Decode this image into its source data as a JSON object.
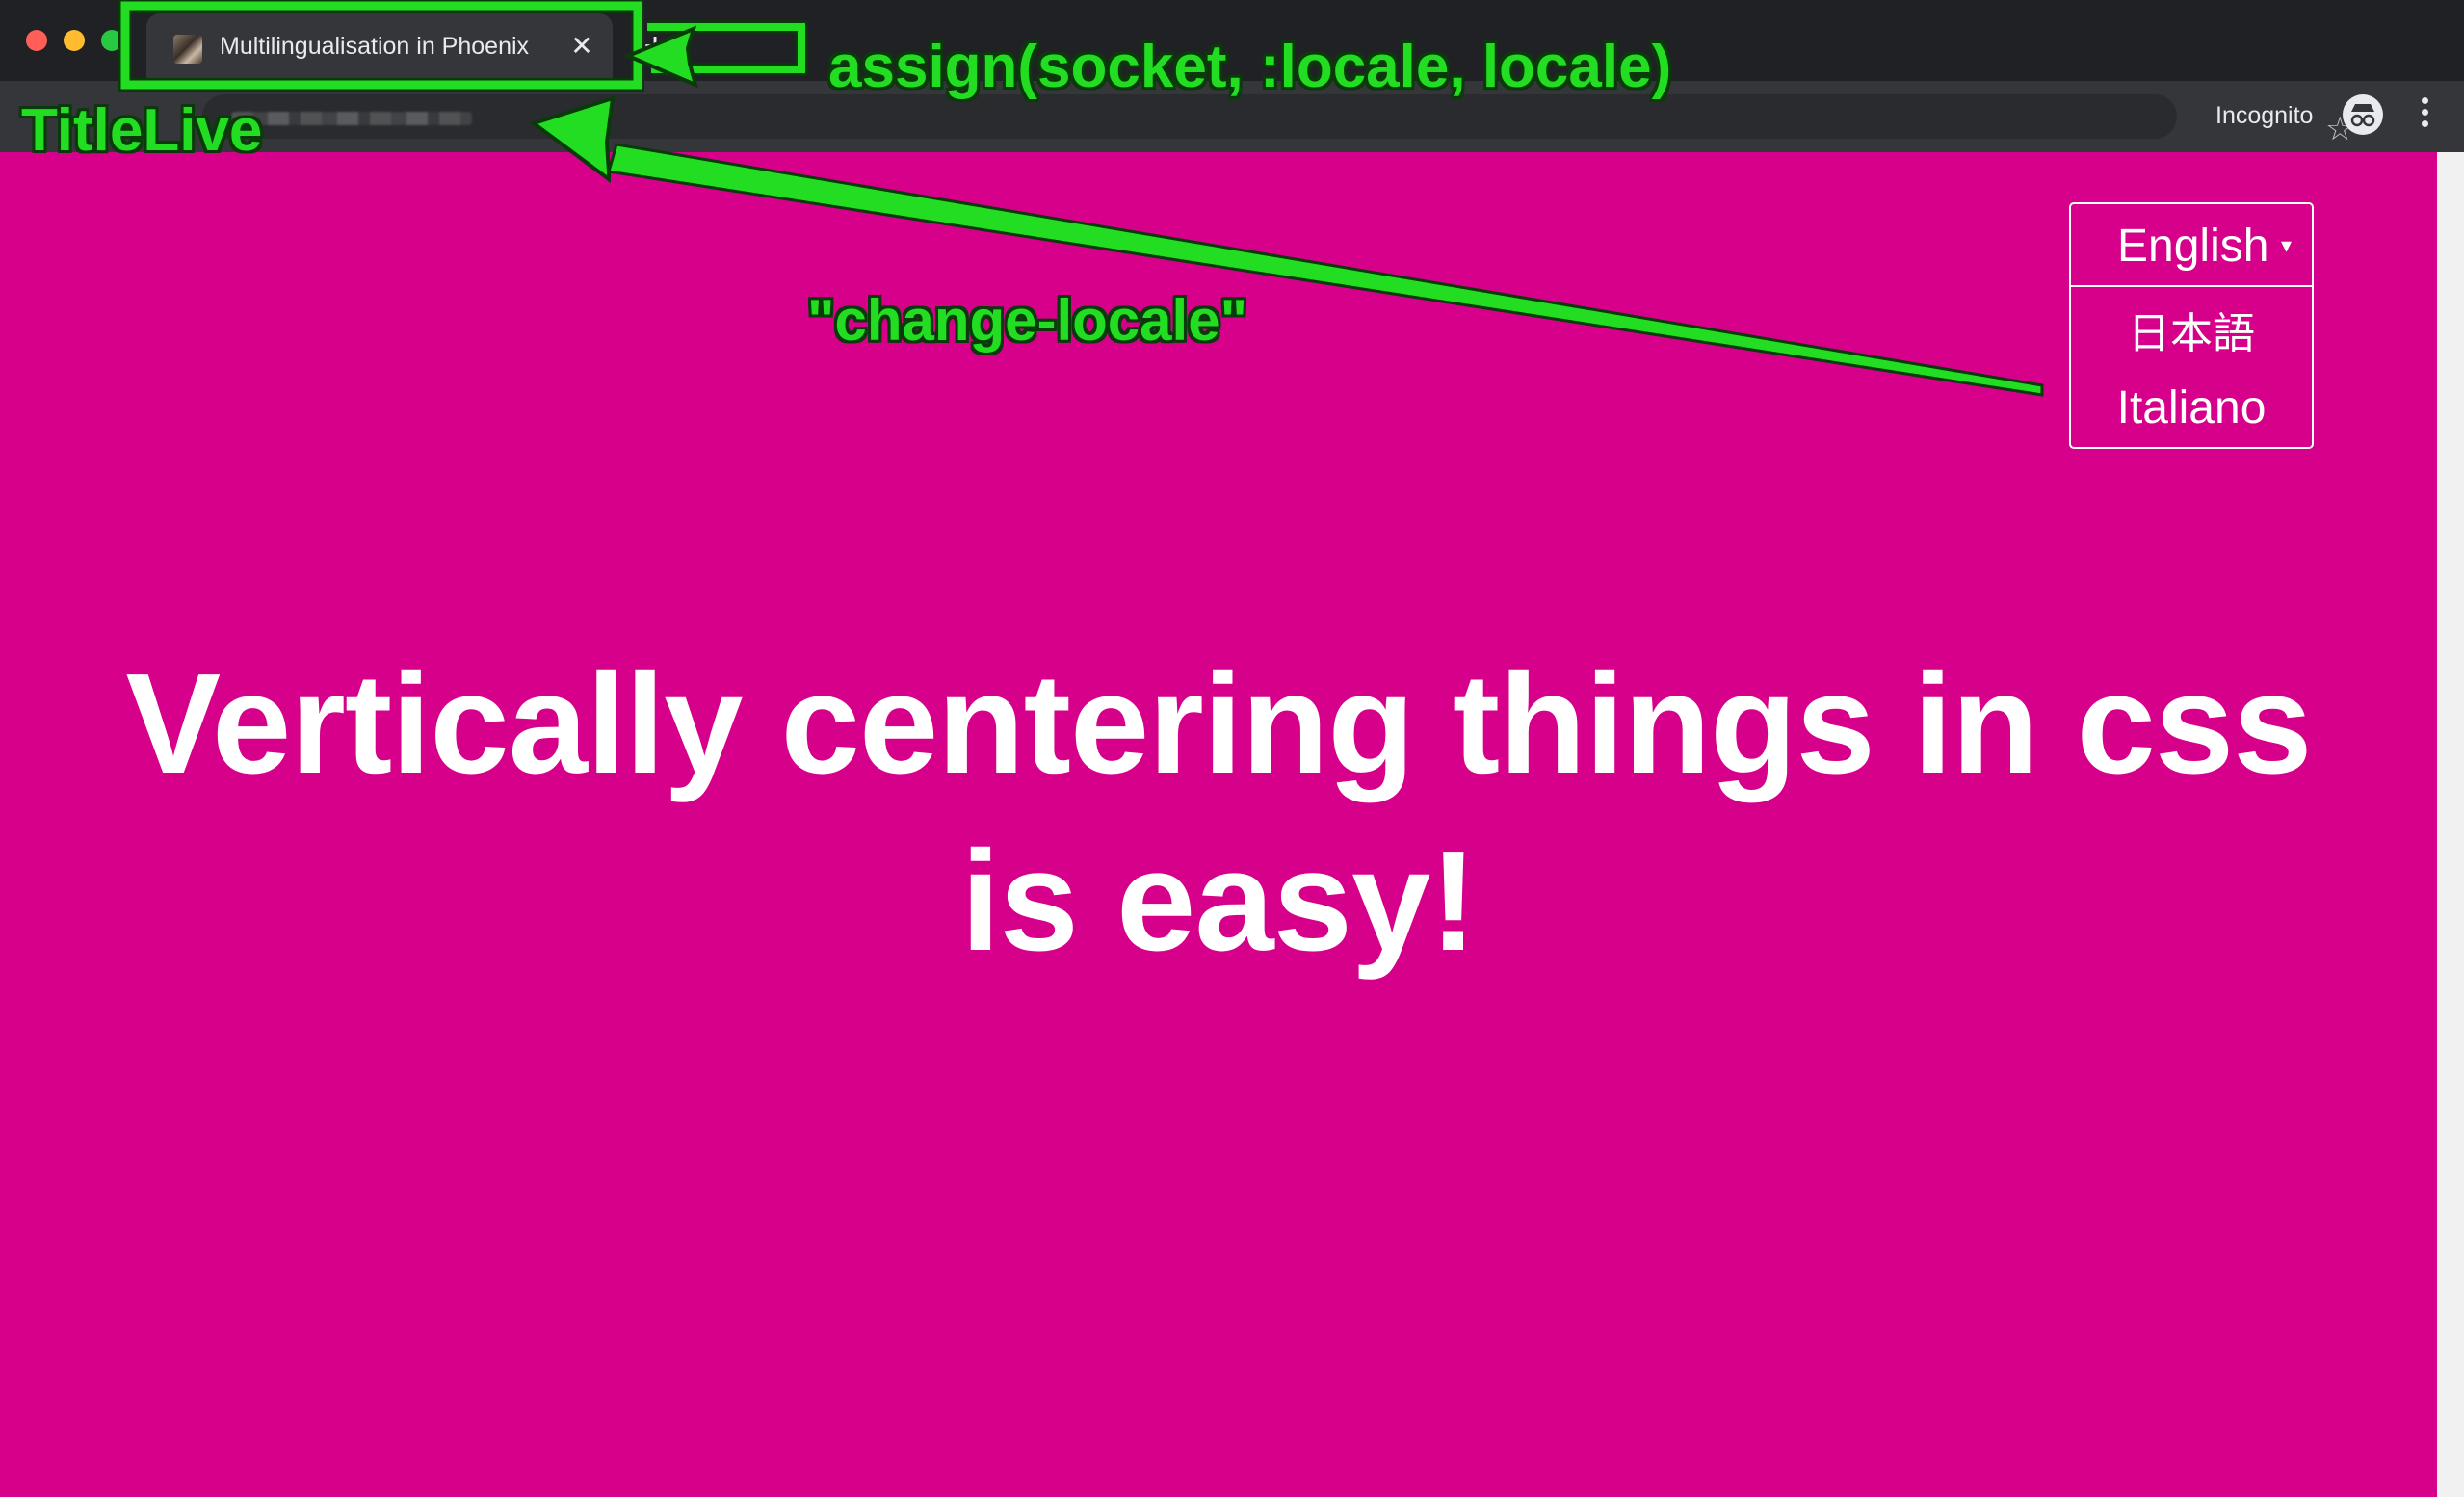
{
  "browser": {
    "tab": {
      "title": "Multilingualisation in Phoenix",
      "close_glyph": "✕",
      "favicon": "phoenix-favicon"
    },
    "new_tab_glyph": "+",
    "toolbar": {
      "star_glyph": "☆",
      "incognito_label": "Incognito",
      "incognito_icon": "incognito-icon",
      "menu_icon": "kebab-menu-icon"
    }
  },
  "page": {
    "background_color": "#d6008b",
    "language_menu": {
      "selected": "English",
      "caret": "▾",
      "options": [
        "日本語",
        "Italiano"
      ]
    },
    "headline": "Vertically centering things in css is easy!"
  },
  "annotations": {
    "assign": "assign(socket, :locale, locale)",
    "title_live": "TitleLive",
    "event": "\"change-locale\"",
    "color": "#22dd22"
  }
}
